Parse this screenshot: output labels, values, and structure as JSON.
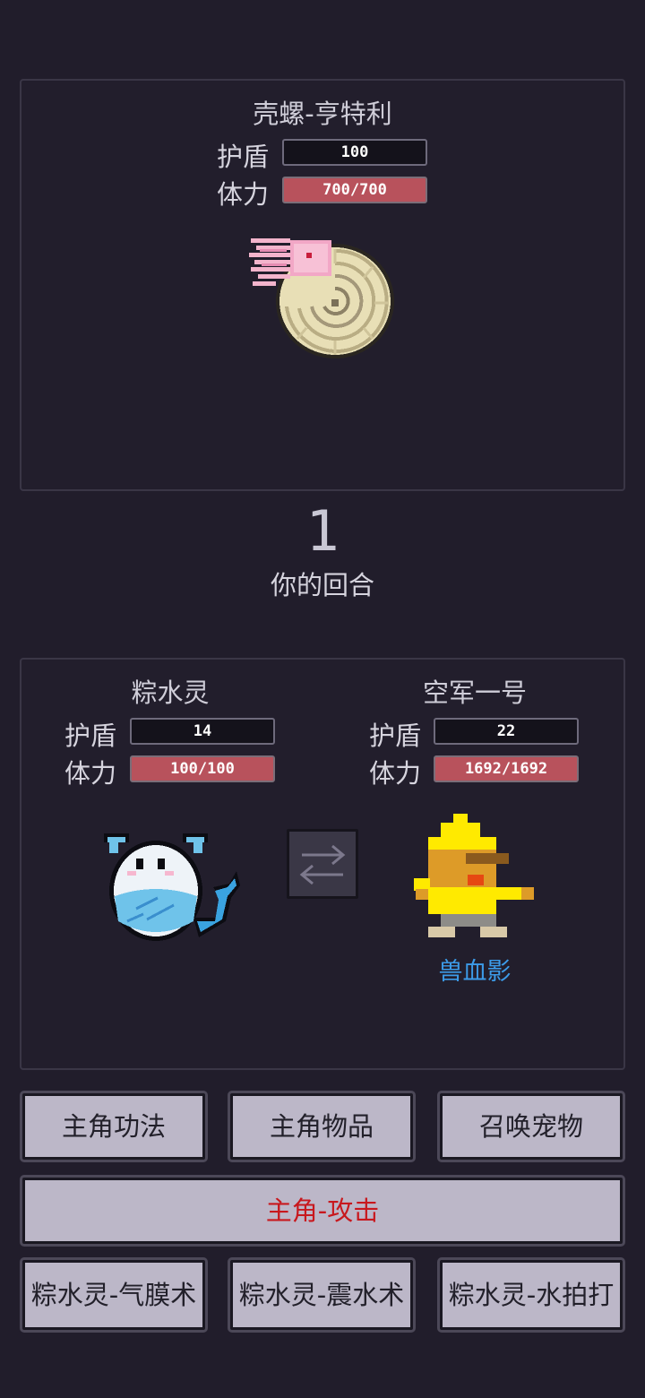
{
  "enemy": {
    "name": "壳螺-亨特利",
    "shield_label": "护盾",
    "shield_value": "100",
    "hp_label": "体力",
    "hp_value": "700/700"
  },
  "turn": {
    "number": "1",
    "label": "你的回合"
  },
  "pet": {
    "name": "粽水灵",
    "shield_label": "护盾",
    "shield_value": "14",
    "hp_label": "体力",
    "hp_value": "100/100"
  },
  "hero": {
    "name": "空军一号",
    "shield_label": "护盾",
    "shield_value": "22",
    "hp_label": "体力",
    "hp_value": "1692/1692",
    "skill_name": "兽血影"
  },
  "buttons": {
    "hero_skills": "主角功法",
    "hero_items": "主角物品",
    "summon_pet": "召唤宠物",
    "hero_attack": "主角-攻击",
    "pet_skill_1": "粽水灵-气膜术",
    "pet_skill_2": "粽水灵-震水术",
    "pet_skill_3": "粽水灵-水拍打"
  },
  "colors": {
    "background": "#211d2b",
    "hp_bar": "#b8525c",
    "button": "#bcb7c8",
    "attack_text": "#c8181e",
    "skill_text": "#3c9be8"
  },
  "icons": {
    "enemy": "ammonite-sprite",
    "pet": "water-spirit-sprite",
    "hero": "yellow-hero-sprite",
    "swap": "swap-arrows-icon"
  }
}
